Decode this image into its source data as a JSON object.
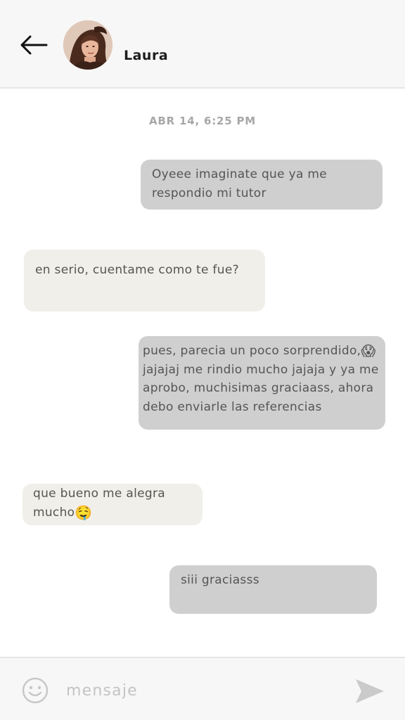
{
  "header": {
    "contact_name": "Laura",
    "icons": {
      "back": "back-arrow-icon",
      "avatar": "avatar"
    }
  },
  "chat": {
    "timestamp": "ABR 14, 6:25 PM",
    "messages": [
      {
        "direction": "sent",
        "text": "Oyeee imaginate que ya me respondio mi tutor"
      },
      {
        "direction": "received",
        "text": "en serio, cuentame como te fue?"
      },
      {
        "direction": "sent",
        "text": "pues, parecia un poco sorprendido,",
        "emoji": "😱",
        "text_after": "jajajaj me rindio mucho jajaja y ya me aprobo, muchisimas graciaass, ahora debo enviarle las referencias"
      },
      {
        "direction": "received",
        "text": "que bueno me alegra mucho",
        "emoji": "🤤"
      },
      {
        "direction": "sent",
        "text": "siii graciasss"
      }
    ]
  },
  "composer": {
    "placeholder": "mensaje",
    "value": "",
    "icons": {
      "emoji": "smiley-icon",
      "send": "send-icon"
    }
  },
  "colors": {
    "sent_bubble": "#cfcfcf",
    "received_bubble": "#f1efe9",
    "header_bg": "#f7f7f7",
    "timestamp": "#a7a7a7",
    "bubble_text": "#555555"
  }
}
